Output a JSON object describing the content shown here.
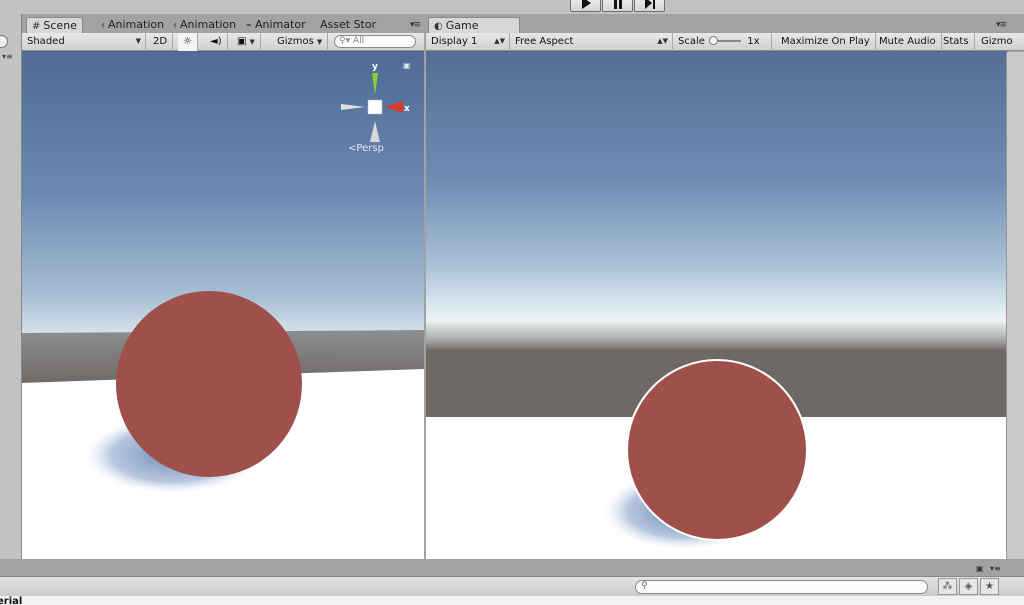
{
  "toolbar_play": {
    "play": "play-icon",
    "pause": "pause-icon",
    "step": "step-icon"
  },
  "scene": {
    "tabs": [
      {
        "label": "Scene",
        "icon": "#"
      },
      {
        "label": "Animation",
        "icon": "‹"
      },
      {
        "label": "Animation",
        "icon": "‹"
      },
      {
        "label": "Animator",
        "icon": "⌁"
      },
      {
        "label": "Asset Stor",
        "icon": ""
      }
    ],
    "shading_mode": "Shaded",
    "mode_2d": "2D",
    "gizmos_label": "Gizmos",
    "search_placeholder": "All",
    "gizmo": {
      "axis_y": "y",
      "axis_x": "x",
      "projection": "Persp"
    }
  },
  "game": {
    "tab_label": "Game",
    "display": "Display 1",
    "aspect": "Free Aspect",
    "scale_label": "Scale",
    "scale_value": "1x",
    "maximize_on_play": "Maximize On Play",
    "mute_audio": "Mute Audio",
    "stats": "Stats",
    "gizmos_label": "Gizmo"
  },
  "console": {
    "footer_text": "erial"
  },
  "colors": {
    "sphere": "#a0504a",
    "sky_top": "#4f6a94",
    "horizon": "#eef5f4",
    "ground_plane": "#ffffff",
    "gizmo_y": "#8ccf34",
    "gizmo_x": "#d83a2a"
  }
}
